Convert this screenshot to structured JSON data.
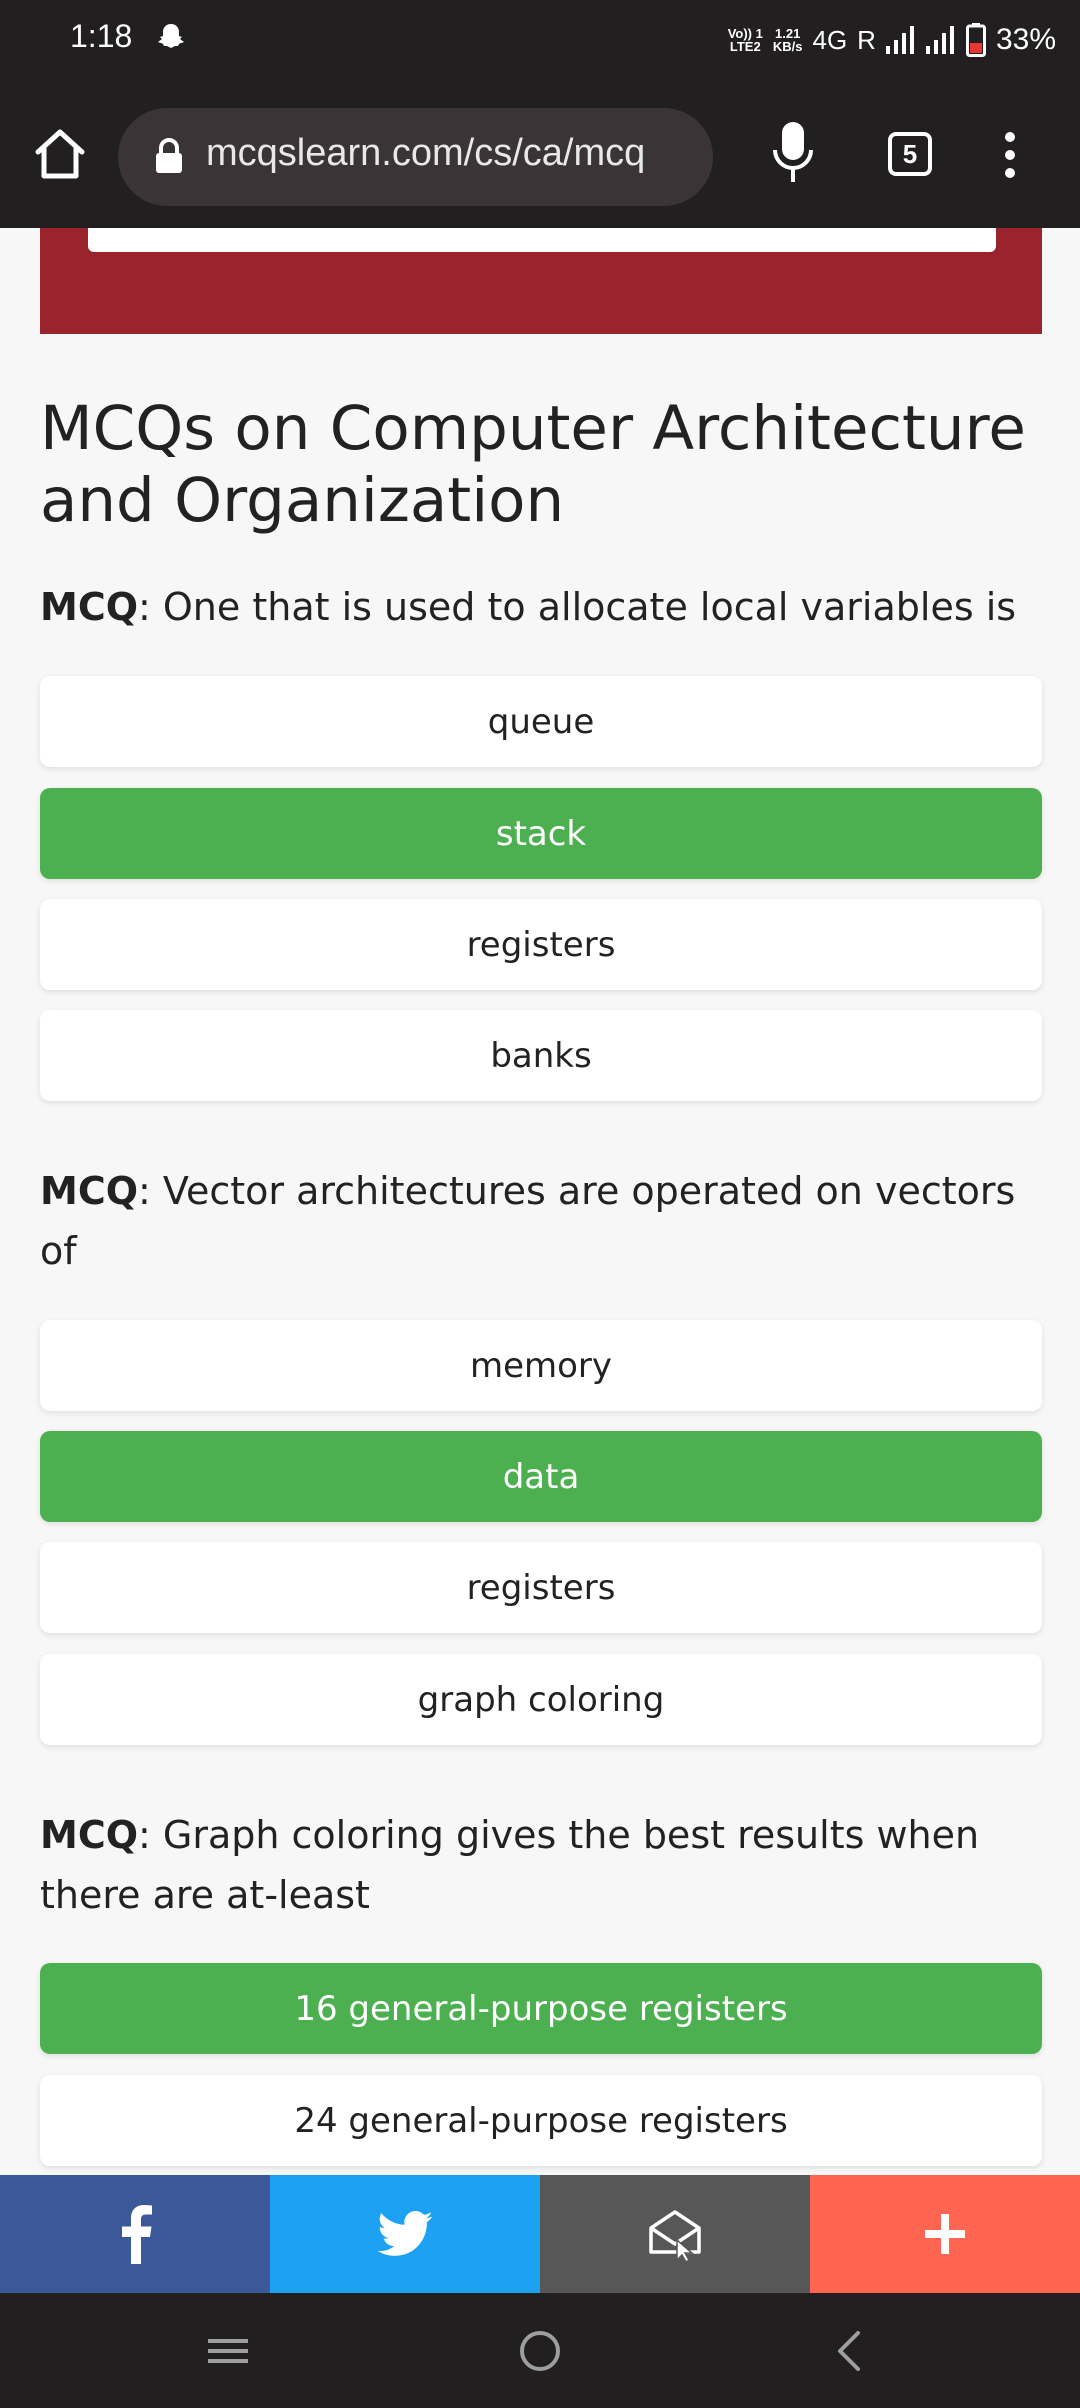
{
  "status_bar": {
    "time": "1:18",
    "volte_top": "Vo)) 1",
    "volte_bottom": "LTE2",
    "speed_top": "1.21",
    "speed_bottom": "KB/s",
    "network": "4G",
    "roaming": "R",
    "battery": "33%"
  },
  "browser": {
    "url": "mcqslearn.com/cs/ca/mcq",
    "tab_count": "5"
  },
  "page": {
    "heading": "MCQs on Computer Architecture and Organization",
    "mcq_tag": "MCQ",
    "questions": [
      {
        "text": ": One that is used to allocate local variables is",
        "options": [
          {
            "label": "queue",
            "correct": false
          },
          {
            "label": "stack",
            "correct": true
          },
          {
            "label": "registers",
            "correct": false
          },
          {
            "label": "banks",
            "correct": false
          }
        ]
      },
      {
        "text": ": Vector architectures are operated on vectors of",
        "options": [
          {
            "label": "memory",
            "correct": false
          },
          {
            "label": "data",
            "correct": true
          },
          {
            "label": "registers",
            "correct": false
          },
          {
            "label": "graph coloring",
            "correct": false
          }
        ]
      },
      {
        "text": ": Graph coloring gives the best results when there are at-least",
        "options": [
          {
            "label": "16 general-purpose registers",
            "correct": true
          },
          {
            "label": "24 general-purpose registers",
            "correct": false
          }
        ]
      }
    ]
  },
  "share_bar": [
    {
      "icon": "facebook-icon",
      "color": "#3b5998"
    },
    {
      "icon": "twitter-icon",
      "color": "#1da1f2"
    },
    {
      "icon": "email-icon",
      "color": "#575757"
    },
    {
      "icon": "plus-icon",
      "color": "#ff6550"
    }
  ],
  "colors": {
    "correct": "#4caf50",
    "banner": "#9a242d",
    "system_bar": "#221f20"
  }
}
